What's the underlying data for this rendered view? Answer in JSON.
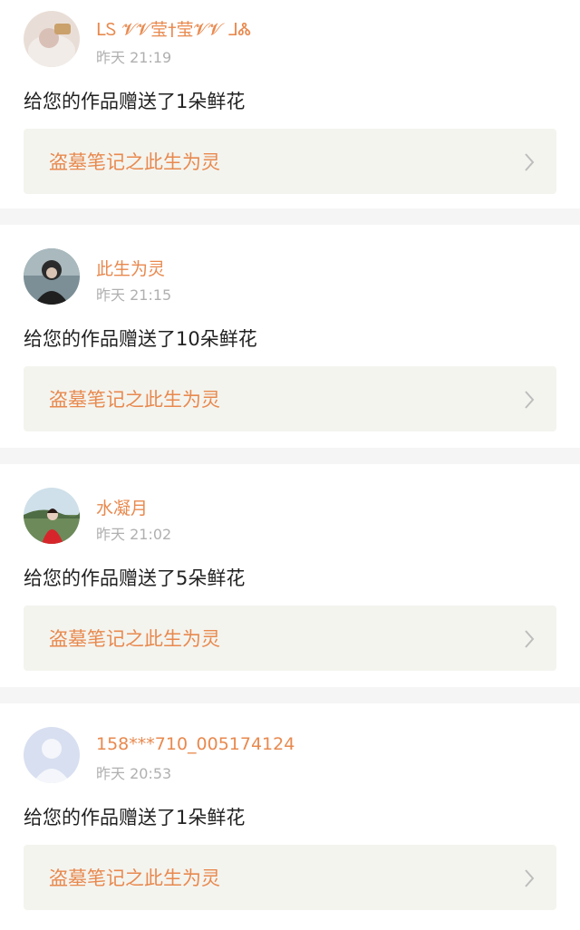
{
  "items": [
    {
      "username": "ᒪᏚ 𝓥𝓥莹†莹𝓥𝓥 ᒧᏜ",
      "time": "昨天 21:19",
      "message": "给您的作品赠送了1朵鲜花",
      "work_title": "盗墓笔记之此生为灵",
      "avatar": "avatar-1-icon"
    },
    {
      "username": "此生为灵",
      "time": "昨天 21:15",
      "message": "给您的作品赠送了10朵鲜花",
      "work_title": "盗墓笔记之此生为灵",
      "avatar": "avatar-2-icon"
    },
    {
      "username": "水凝月",
      "time": "昨天 21:02",
      "message": "给您的作品赠送了5朵鲜花",
      "work_title": "盗墓笔记之此生为灵",
      "avatar": "avatar-3-icon"
    },
    {
      "username": "158***710_005174124",
      "time": "昨天 20:53",
      "message": "给您的作品赠送了1朵鲜花",
      "work_title": "盗墓笔记之此生为灵",
      "avatar": "default-avatar-icon"
    }
  ],
  "colors": {
    "accent": "#e8894e",
    "card_bg": "#ffffff",
    "link_bg": "#f4f4ef",
    "time_gray": "#b0b0b0",
    "separator": "#f5f5f5"
  }
}
